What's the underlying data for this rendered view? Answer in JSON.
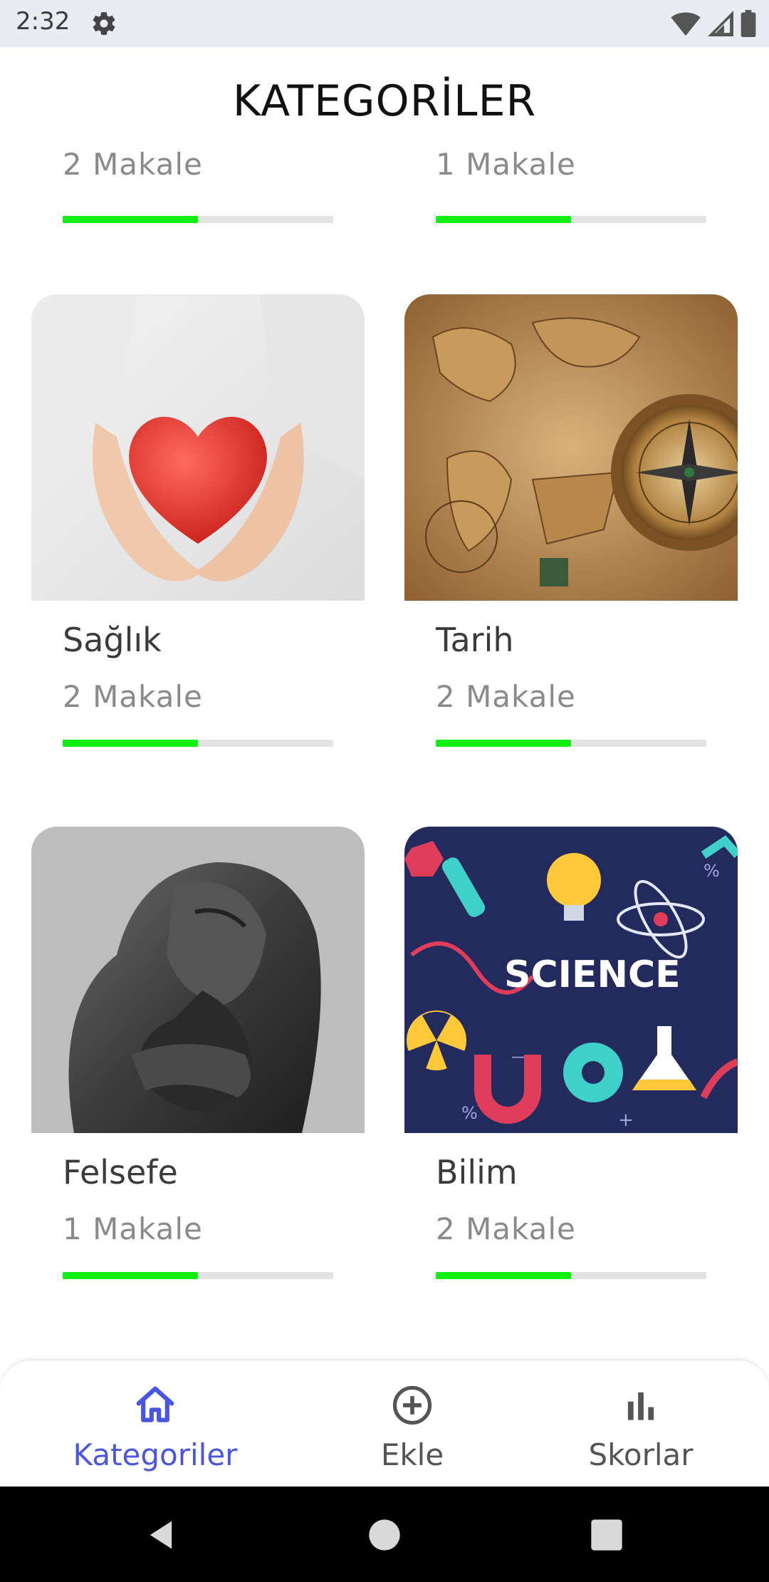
{
  "status_bar": {
    "time": "2:32"
  },
  "header": {
    "title": "KATEGORİLER"
  },
  "partial_row": [
    {
      "count": "2 Makale",
      "progress": 0.5
    },
    {
      "count": "1 Makale",
      "progress": 0.5
    }
  ],
  "categories": [
    {
      "title": "Sağlık",
      "count": "2 Makale",
      "progress": 0.5,
      "image": "heart-in-hands"
    },
    {
      "title": "Tarih",
      "count": "2 Makale",
      "progress": 0.5,
      "image": "old-map-compass"
    },
    {
      "title": "Felsefe",
      "count": "1 Makale",
      "progress": 0.5,
      "image": "thinker-statue"
    },
    {
      "title": "Bilim",
      "count": "2 Makale",
      "progress": 0.5,
      "image": "science-illustration"
    }
  ],
  "science_image_text": "SCIENCE",
  "bottom_nav": {
    "items": [
      {
        "label": "Kategoriler",
        "icon": "home-icon",
        "active": true
      },
      {
        "label": "Ekle",
        "icon": "add-circle-icon",
        "active": false
      },
      {
        "label": "Skorlar",
        "icon": "bar-chart-icon",
        "active": false
      }
    ]
  },
  "colors": {
    "accent": "#4a56e2",
    "progress_fill": "#11ee11",
    "progress_track": "#e3e3e3"
  }
}
